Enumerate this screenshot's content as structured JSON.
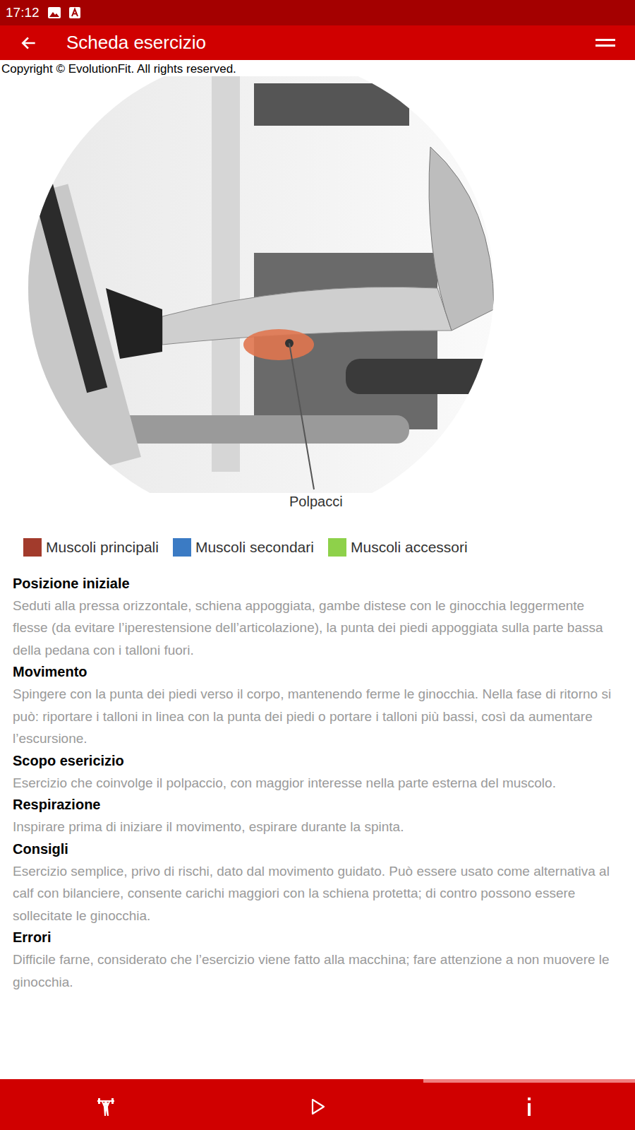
{
  "status_bar": {
    "time": "17:12"
  },
  "header": {
    "title": "Scheda esercizio"
  },
  "image": {
    "copyright": "Copyright © EvolutionFit. All rights reserved.",
    "label": "Polpacci"
  },
  "legend": [
    {
      "label": "Muscoli principali",
      "color": "#a23b2c"
    },
    {
      "label": "Muscoli secondari",
      "color": "#3b7bc4"
    },
    {
      "label": "Muscoli accessori",
      "color": "#8ed14a"
    }
  ],
  "sections": [
    {
      "title": "Posizione iniziale",
      "text": "Seduti alla pressa orizzontale, schiena appoggiata, gambe distese con le ginocchia leggermente flesse (da evitare l’iperestensione dell’articolazione), la punta dei piedi appoggiata sulla parte bassa della pedana con i talloni fuori."
    },
    {
      "title": "Movimento",
      "text": "Spingere con la punta dei piedi verso il corpo, mantenendo ferme le ginocchia. Nella fase di ritorno si può: riportare i talloni in linea con la punta dei piedi o portare i talloni più bassi, così da aumentare l’escursione."
    },
    {
      "title": "Scopo esericizio",
      "text": "Esercizio che coinvolge il polpaccio, con maggior interesse nella parte esterna del muscolo."
    },
    {
      "title": "Respirazione",
      "text": "Inspirare prima di iniziare il movimento, espirare durante la spinta."
    },
    {
      "title": "Consigli",
      "text": "Esercizio semplice, privo di rischi, dato dal movimento guidato. Può essere usato come alternativa al calf con bilanciere, consente carichi maggiori con la schiena protetta; di contro possono essere sollecitate le ginocchia."
    },
    {
      "title": "Errori",
      "text": "Difficile farne, considerato che l’esercizio viene fatto alla macchina; fare attenzione a non muovere le ginocchia."
    }
  ],
  "bottom_nav": [
    {
      "kind": "exercise",
      "selected": false
    },
    {
      "kind": "play",
      "selected": false
    },
    {
      "kind": "info",
      "selected": true
    }
  ]
}
